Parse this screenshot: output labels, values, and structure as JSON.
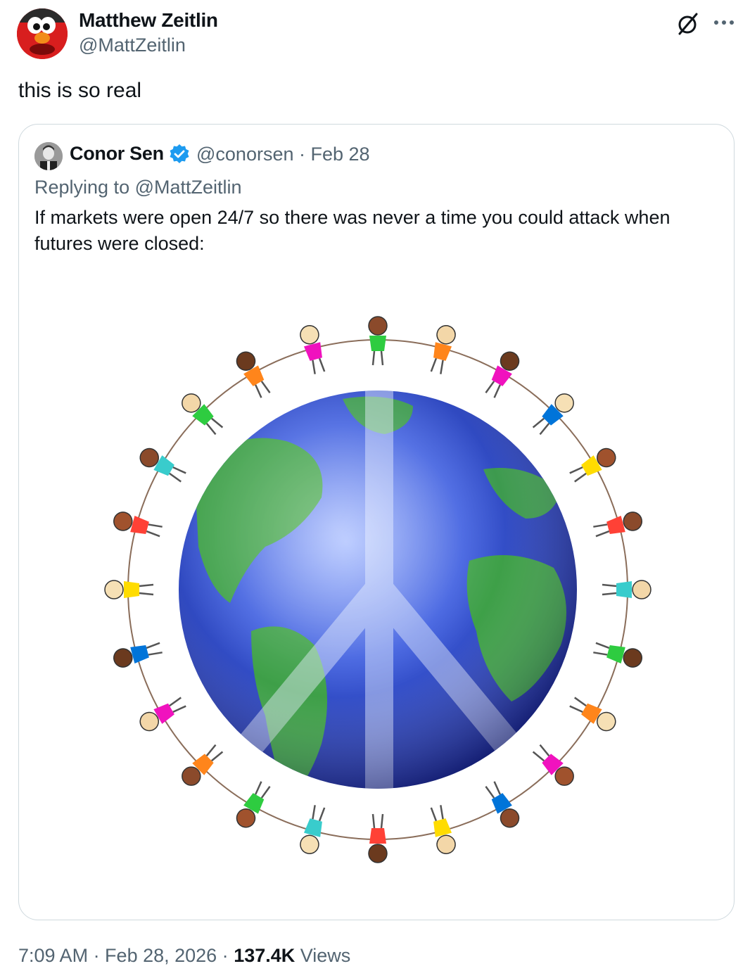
{
  "author": {
    "display_name": "Matthew Zeitlin",
    "handle": "@MattZeitlin",
    "avatar": "elmo-avatar"
  },
  "icons": {
    "grok": "grok-icon",
    "more": "more-options-icon",
    "verified": "verified-badge-icon",
    "verified_color": "#1d9bf0"
  },
  "tweet": {
    "text": "this is so real"
  },
  "quote": {
    "display_name": "Conor Sen",
    "handle_date": "@conorsen · Feb 28",
    "replying_to": "Replying to @MattZeitlin",
    "text": "If markets were open 24/7 so there was never a time you could attack when futures were closed:",
    "image": "globe-peace-sign-with-kids-holding-hands"
  },
  "meta": {
    "time_date": "7:09 AM · Feb 28, 2026 · ",
    "views_count": "137.4K",
    "views_label": " Views"
  },
  "colors": {
    "text_primary": "#0f1419",
    "text_secondary": "#536471",
    "border": "#cfd9de"
  }
}
